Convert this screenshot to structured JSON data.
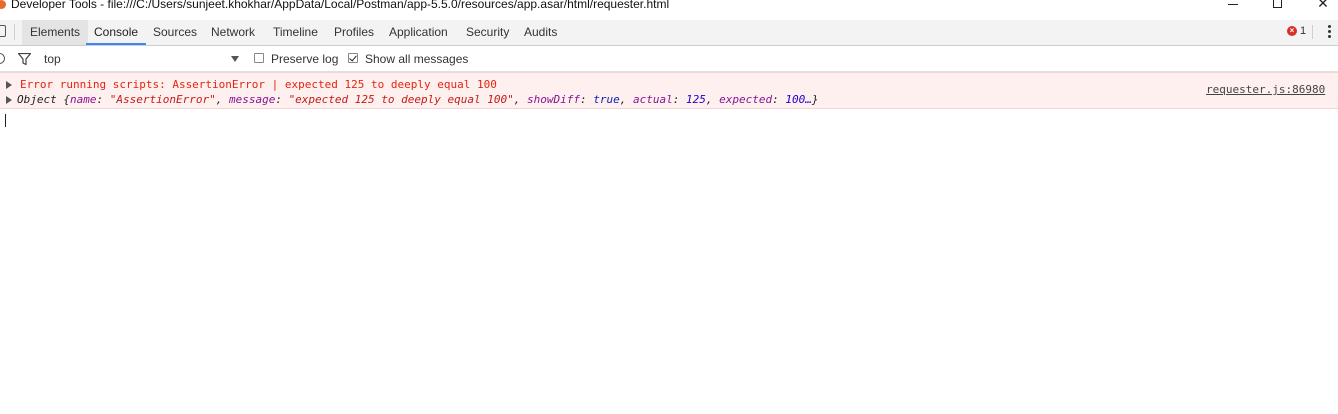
{
  "window": {
    "title": "Developer Tools - file:///C:/Users/sunjeet.khokhar/AppData/Local/Postman/app-5.5.0/resources/app.asar/html/requester.html",
    "min_icon": "minimize-icon",
    "max_icon": "maximize-icon",
    "close_icon": "close-icon",
    "close_glyph": "✕"
  },
  "tabs": [
    {
      "label": "Elements"
    },
    {
      "label": "Console",
      "active": true
    },
    {
      "label": "Sources"
    },
    {
      "label": "Network"
    },
    {
      "label": "Timeline"
    },
    {
      "label": "Profiles"
    },
    {
      "label": "Application"
    },
    {
      "label": "Security"
    },
    {
      "label": "Audits"
    }
  ],
  "status": {
    "error_badge_glyph": "×",
    "error_count": "1"
  },
  "console_toolbar": {
    "context": "top",
    "preserve_log": {
      "label": "Preserve log",
      "checked": false
    },
    "show_all": {
      "label": "Show all messages",
      "checked": true
    }
  },
  "messages": {
    "error_text": "Error running scripts: AssertionError | expected 125 to deeply equal 100",
    "source": "requester.js:86980",
    "object": {
      "prefix": "Object {",
      "k_name": "name",
      "v_name": "\"AssertionError\"",
      "k_message": "message",
      "v_message": "\"expected 125 to deeply equal 100\"",
      "k_showDiff": "showDiff",
      "v_showDiff": "true",
      "k_actual": "actual",
      "v_actual": "125",
      "k_expected": "expected",
      "v_expected": "100…",
      "suffix": "}"
    }
  },
  "colors": {
    "error_text": "#e6230f",
    "error_bg": "#fff0f0",
    "active_tab_underline": "#4285f4",
    "error_badge": "#d93025"
  }
}
